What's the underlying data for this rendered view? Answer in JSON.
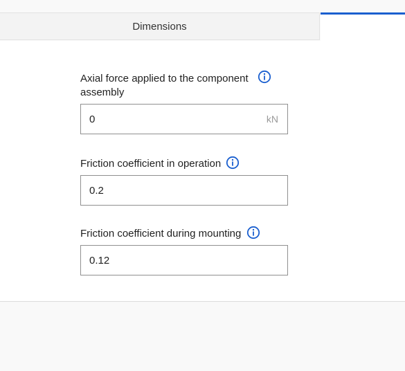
{
  "tabs": {
    "dimensions_label": "Dimensions"
  },
  "fields": {
    "axial_force": {
      "label": "Axial force applied to the component assembly",
      "value": "0",
      "unit": "kN"
    },
    "friction_operation": {
      "label": "Friction coefficient in operation",
      "value": "0.2"
    },
    "friction_mounting": {
      "label": "Friction coefficient during mounting",
      "value": "0.12"
    }
  },
  "colors": {
    "accent": "#1a5fcf",
    "info_icon": "#1a5fcf"
  },
  "icons": {
    "info": "info-circle-icon"
  }
}
